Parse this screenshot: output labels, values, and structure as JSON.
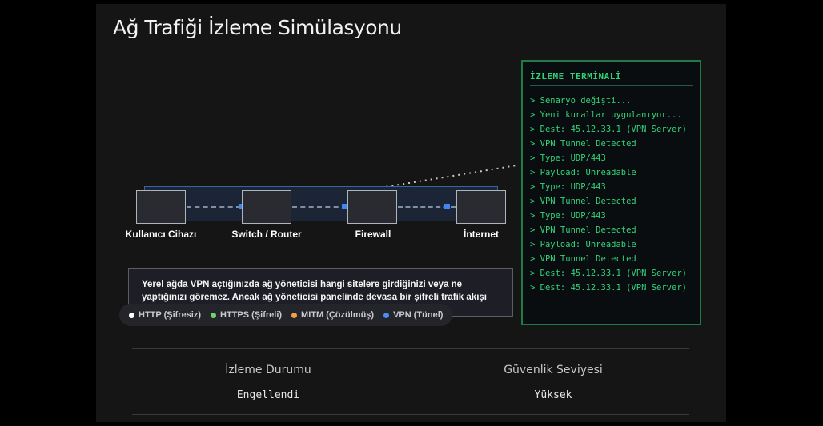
{
  "page": {
    "title": "Ağ Trafiği İzleme Simülasyonu"
  },
  "diagram": {
    "devices": [
      {
        "label": "Kullanıcı Cihazı"
      },
      {
        "label": "Switch / Router"
      },
      {
        "label": "Firewall"
      },
      {
        "label": "İnternet"
      }
    ],
    "info_text": "Yerel ağda VPN açtığınızda ağ yöneticisi hangi sitelere girdiğinizi veya ne yaptığınızı göremez. Ancak ağ yöneticisi panelinde devasa bir şifreli trafik akışı",
    "legend": [
      {
        "label": "HTTP (Şifresiz)",
        "color": "#ffffff"
      },
      {
        "label": "HTTPS (Şifreli)",
        "color": "#6fd36f"
      },
      {
        "label": "MITM (Çözülmüş)",
        "color": "#f0a04b"
      },
      {
        "label": "VPN (Tünel)",
        "color": "#4a8ef0"
      }
    ]
  },
  "terminal": {
    "title": "İZLEME TERMİNALİ",
    "lines": [
      "> Senaryo değişti...",
      "> Yeni kurallar uygulanıyor...",
      "> Dest: 45.12.33.1 (VPN Server)",
      "> VPN Tunnel Detected",
      "> Type: UDP/443",
      "> Payload: Unreadable",
      "> Type: UDP/443",
      "> VPN Tunnel Detected",
      "> Type: UDP/443",
      "> VPN Tunnel Detected",
      "> Payload: Unreadable",
      "> VPN Tunnel Detected",
      "> Dest: 45.12.33.1 (VPN Server)",
      "> Dest: 45.12.33.1 (VPN Server)"
    ]
  },
  "stats": {
    "monitoring": {
      "label": "İzleme Durumu",
      "value": "Engellendi"
    },
    "security": {
      "label": "Güvenlik Seviyesi",
      "value": "Yüksek"
    }
  },
  "colors": {
    "accent_blue": "#3f86f0",
    "terminal_green": "#33d17a"
  }
}
